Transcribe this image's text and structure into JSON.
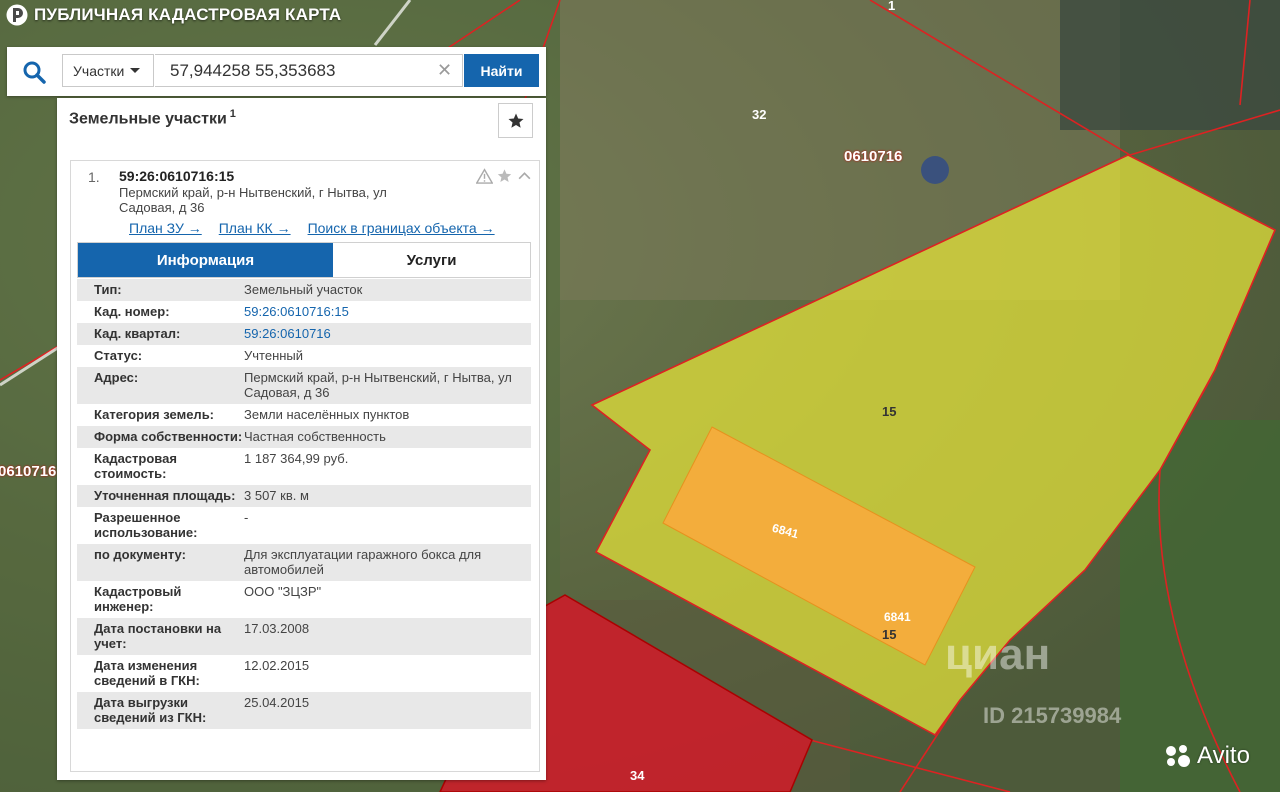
{
  "header": {
    "title": "ПУБЛИЧНАЯ КАДАСТРОВАЯ КАРТА",
    "logo_icon": "pkk-logo-icon"
  },
  "search": {
    "icon": "search-icon",
    "scope": "Участки",
    "value": "57,944258 55,353683",
    "clear_icon": "clear-icon",
    "button": "Найти"
  },
  "panel": {
    "title": "Земельные участки",
    "count": "1",
    "favorite_icon": "star-icon"
  },
  "result": {
    "number": "1.",
    "cad_number": "59:26:0610716:15",
    "address": "Пермский край, р-н Нытвенский, г Нытва, ул Садовая, д 36",
    "links": [
      "План ЗУ →",
      "План КК →",
      "Поиск в границах объекта →"
    ],
    "tabs": [
      "Информация",
      "Услуги"
    ],
    "rows": [
      {
        "k": "Тип:",
        "v": "Земельный участок"
      },
      {
        "k": "Кад. номер:",
        "v": "59:26:0610716:15"
      },
      {
        "k": "Кад. квартал:",
        "v": "59:26:0610716"
      },
      {
        "k": "Статус:",
        "v": "Учтенный"
      },
      {
        "k": "Адрес:",
        "v": "Пермский край, р-н Нытвенский, г Нытва, ул Садовая, д 36"
      },
      {
        "k": "Категория земель:",
        "v": "Земли населённых пунктов"
      },
      {
        "k": "Форма собственности:",
        "v": "Частная собственность"
      },
      {
        "k": "Кадастровая стоимость:",
        "v": "1 187 364,99 руб."
      },
      {
        "k": "Уточненная площадь:",
        "v": "3 507 кв. м"
      },
      {
        "k": "Разрешенное использование:",
        "v": "-"
      },
      {
        "k": "по документу:",
        "v": "Для эксплуатации гаражного бокса для автомобилей"
      },
      {
        "k": "Кадастровый инженер:",
        "v": "ООО \"ЗЦЗР\""
      },
      {
        "k": "Дата постановки на учет:",
        "v": "17.03.2008"
      },
      {
        "k": "Дата изменения сведений в ГКН:",
        "v": "12.02.2015"
      },
      {
        "k": "Дата выгрузки сведений из ГКН:",
        "v": "25.04.2015"
      }
    ]
  },
  "map_labels": {
    "l1": "1",
    "l32": "32",
    "q1": "0610716",
    "q2": "0610716",
    "l15a": "15",
    "l15b": "15",
    "b1": "6841",
    "b2": "6841",
    "l34": "34"
  },
  "watermarks": {
    "cian": "циан",
    "cian_id": "ID 215739984",
    "avito": "Avito"
  },
  "colors": {
    "accent": "#1565ad",
    "parcel": "#e8e63a",
    "building": "#f6ac3c",
    "neighbor": "#c9202a"
  }
}
